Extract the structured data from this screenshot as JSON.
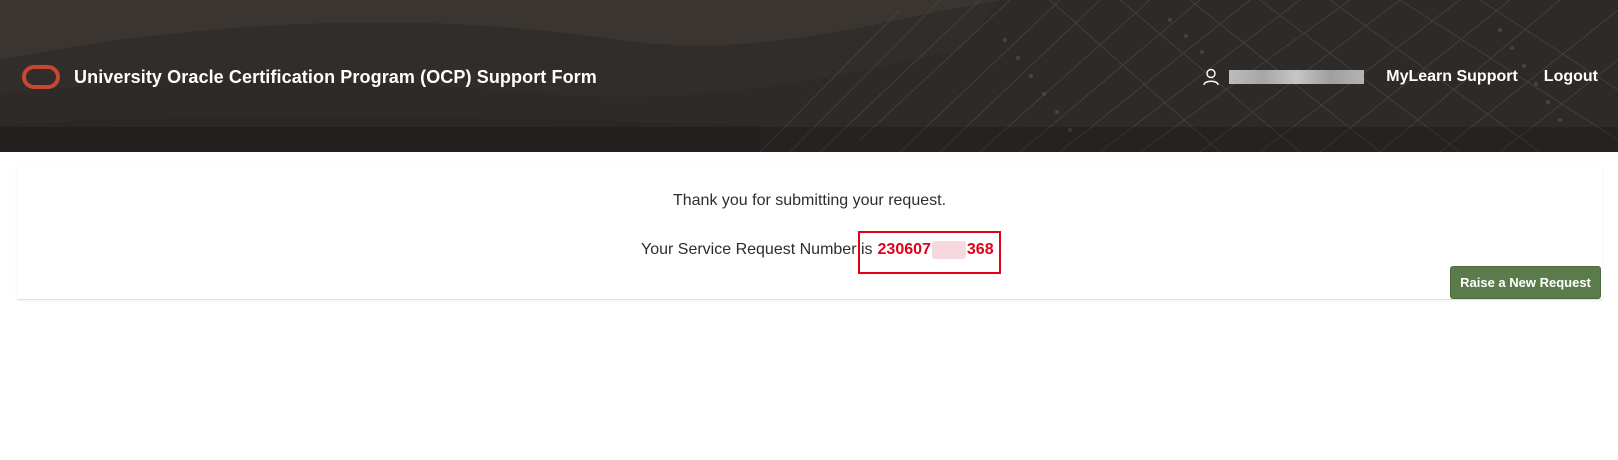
{
  "header": {
    "app_title": "University Oracle Certification Program (OCP) Support Form",
    "logo_icon": "oracle-logo-icon",
    "user": {
      "icon": "user-icon",
      "name": "",
      "masked": true
    },
    "nav": {
      "support_label": "MyLearn Support",
      "logout_label": "Logout"
    }
  },
  "confirmation": {
    "thanks_message": "Thank you for submitting your request.",
    "sr_label": "Your Service Request Number is",
    "sr_prefix": "230607",
    "sr_suffix": "368",
    "sr_masked": true
  },
  "actions": {
    "raise_new_request_label": "Raise a New Request"
  },
  "colors": {
    "header_bg": "#312d2a",
    "accent_red": "#c74634",
    "sr_number": "#e3001b",
    "button_green": "#5b7b4a"
  }
}
